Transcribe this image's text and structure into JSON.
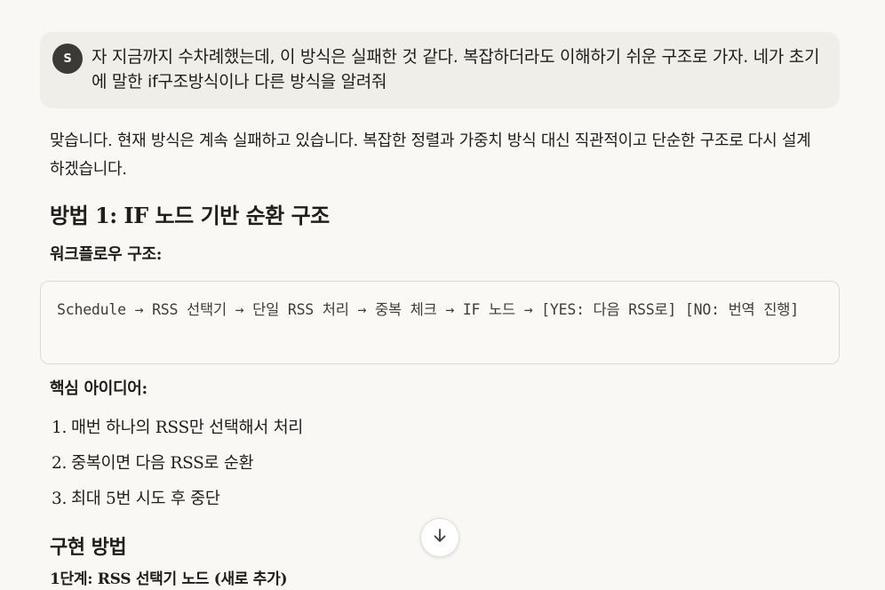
{
  "user_message": {
    "avatar_initial": "S",
    "text": "자 지금까지 수차례했는데, 이 방식은 실패한 것 같다. 복잡하더라도 이해하기 쉬운 구조로 가자. 네가 초기에 말한 if구조방식이나 다른 방식을 알려줘"
  },
  "reply": {
    "intro": "맞습니다. 현재 방식은 계속 실패하고 있습니다. 복잡한 정렬과 가중치 방식 대신 직관적이고 단순한 구조로 다시 설계하겠습니다.",
    "method_heading": "방법 1: IF 노드 기반 순환 구조",
    "workflow_label": "워크플로우 구조:",
    "workflow_code": "Schedule → RSS 선택기 → 단일 RSS 처리 → 중복 체크 → IF 노드 → [YES: 다음 RSS로] [NO: 번역 진행]",
    "core_idea_label": "핵심 아이디어:",
    "core_ideas": [
      {
        "num": "1.",
        "text": "매번 하나의 RSS만 선택해서 처리"
      },
      {
        "num": "2.",
        "text": "중복이면 다음 RSS로 순환"
      },
      {
        "num": "3.",
        "text": "최대 5번 시도 후 중단"
      }
    ],
    "implementation_heading": "구현 방법",
    "cut_off_line": "1단계: RSS 선택기 노드 (새로 추가)"
  },
  "controls": {
    "scroll_down_icon": "arrow-down-icon"
  }
}
